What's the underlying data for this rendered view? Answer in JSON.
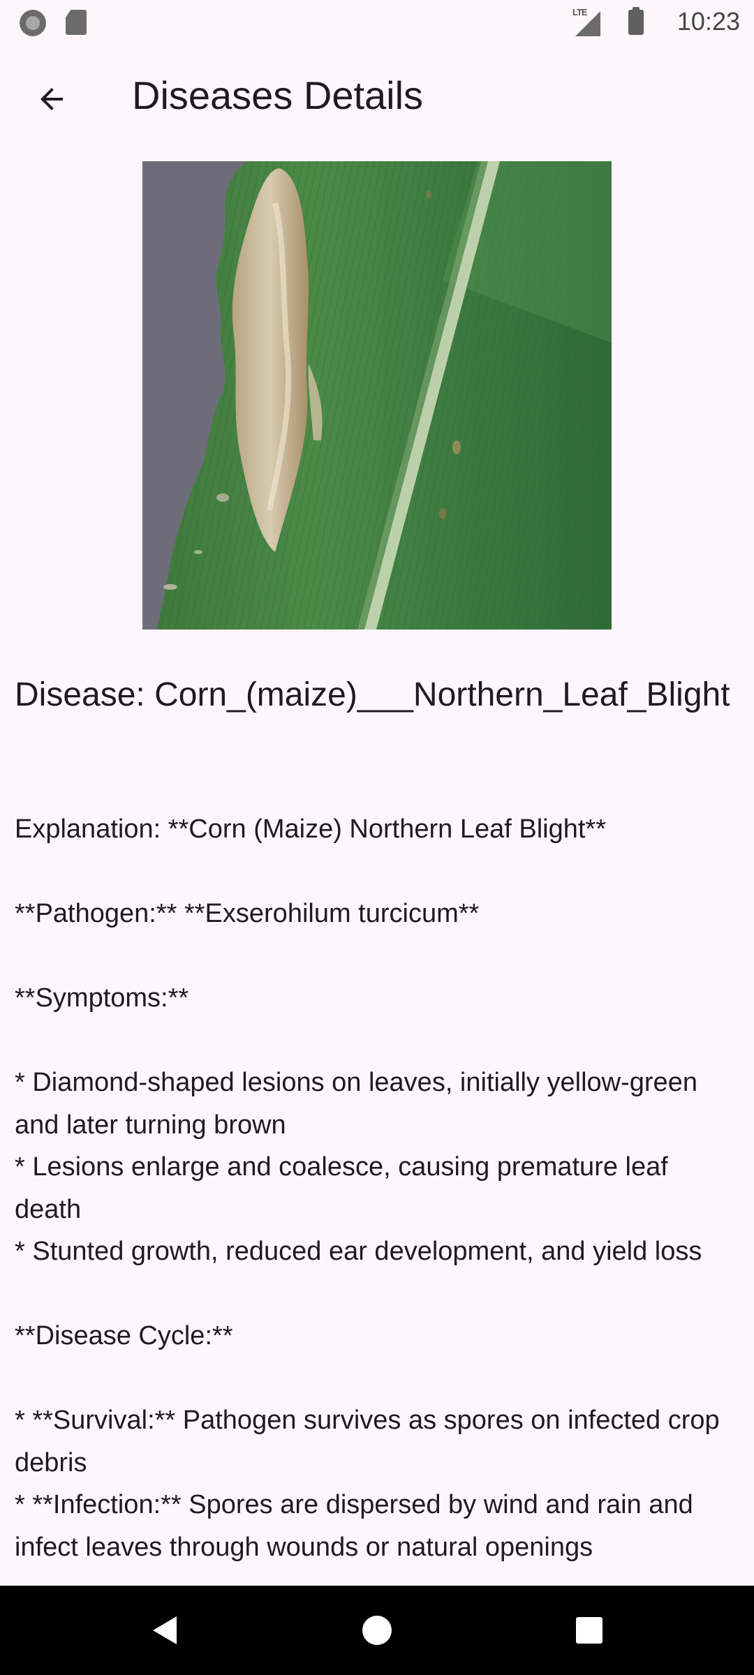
{
  "status_bar": {
    "time": "10:23",
    "network_label": "LTE",
    "icons": [
      "screen-record-icon",
      "sd-card-icon",
      "lte-signal-icon",
      "battery-icon"
    ]
  },
  "app_bar": {
    "title": "Diseases Details",
    "back_icon": "arrow-back-icon"
  },
  "disease": {
    "image_alt": "corn-leaf-photo",
    "name_line": "Disease: Corn_(maize)___Northern_Leaf_Blight",
    "explanation": "Explanation: **Corn (Maize) Northern Leaf Blight**\n\n**Pathogen:** **Exserohilum turcicum**\n\n**Symptoms:**\n\n* Diamond-shaped lesions on leaves, initially yellow-green and later turning brown\n* Lesions enlarge and coalesce, causing premature leaf death\n* Stunted growth, reduced ear development, and yield loss\n\n**Disease Cycle:**\n\n* **Survival:** Pathogen survives as spores on infected crop debris\n* **Infection:** Spores are dispersed by wind and rain and infect leaves through wounds or natural openings"
  },
  "nav_bar": {
    "buttons": [
      "nav-back",
      "nav-home",
      "nav-recents"
    ]
  },
  "colors": {
    "background": "#fdf7fc",
    "text": "#1d1b20",
    "nav_bar": "#000000"
  }
}
